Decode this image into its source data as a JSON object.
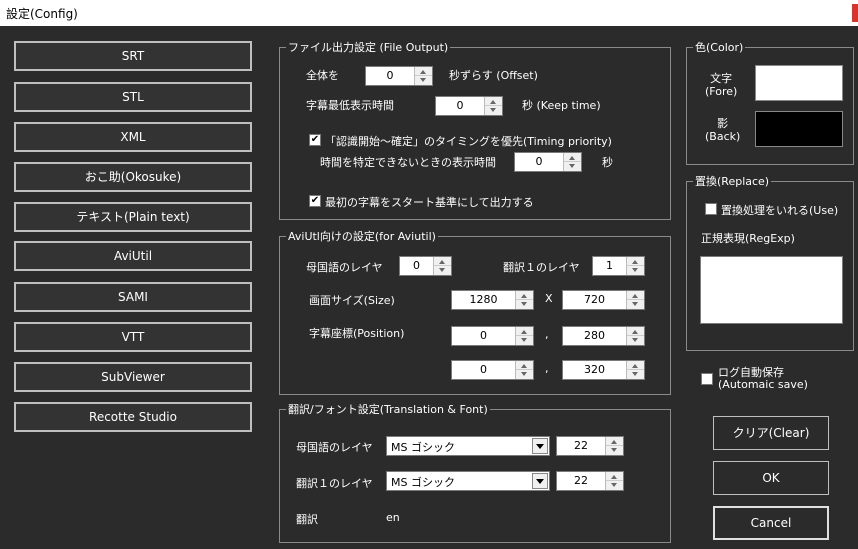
{
  "window": {
    "title": "設定(Config)"
  },
  "formats": [
    "SRT",
    "STL",
    "XML",
    "おこ助(Okosuke)",
    "テキスト(Plain text)",
    "AviUtil",
    "SAMI",
    "VTT",
    "SubViewer",
    "Recotte Studio"
  ],
  "file_output": {
    "legend": "ファイル出力設定 (File Output)",
    "offset_prefix": "全体を",
    "offset_value": "0",
    "offset_suffix": "秒ずらす (Offset)",
    "keep_label": "字幕最低表示時間",
    "keep_value": "0",
    "keep_suffix": "秒 (Keep time)",
    "timing_label": "「認識開始〜確定」のタイミングを優先(Timing priority)",
    "timing_checked": true,
    "unknown_label": "時間を特定できないときの表示時間",
    "unknown_value": "0",
    "unknown_suffix": "秒",
    "start_label": "最初の字幕をスタート基準にして出力する",
    "start_checked": true
  },
  "aviutil": {
    "legend": "AviUtl向けの設定(for Aviutil)",
    "native_layer_label": "母国語のレイヤ",
    "native_layer_value": "0",
    "trans_layer_label": "翻訳１のレイヤ",
    "trans_layer_value": "1",
    "size_label": "画面サイズ(Size)",
    "size_w": "1280",
    "size_sep": "X",
    "size_h": "720",
    "pos_label": "字幕座標(Position)",
    "pos1_x": "0",
    "pos1_y": "280",
    "pos2_x": "0",
    "pos2_y": "320",
    "comma": ","
  },
  "font": {
    "legend": "翻訳/フォント設定(Translation & Font)",
    "native_label": "母国語のレイヤ",
    "native_font": "MS ゴシック",
    "native_size": "22",
    "trans_label": "翻訳１のレイヤ",
    "trans_font": "MS ゴシック",
    "trans_size": "22",
    "translation_label": "翻訳",
    "translation_value": "en"
  },
  "color": {
    "legend": "色(Color)",
    "fore_label_1": "文字",
    "fore_label_2": "(Fore)",
    "fore_color": "#ffffff",
    "back_label_1": "影",
    "back_label_2": "(Back)",
    "back_color": "#000000"
  },
  "replace": {
    "legend": "置換(Replace)",
    "use_label": "置換処理をいれる(Use)",
    "use_checked": false,
    "regexp_label": "正規表現(RegExp)",
    "regexp_value": ""
  },
  "autosave": {
    "label_1": "ログ自動保存",
    "label_2": "(Automaic save)",
    "checked": false
  },
  "actions": {
    "clear": "クリア(Clear)",
    "ok": "OK",
    "cancel": "Cancel"
  }
}
